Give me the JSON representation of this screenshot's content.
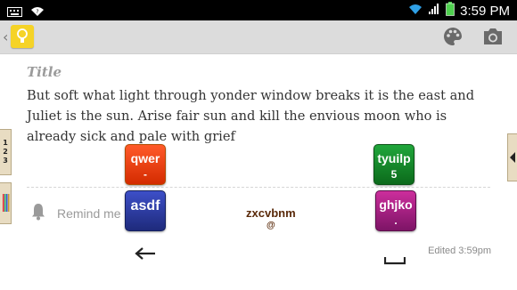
{
  "status_bar": {
    "time": "3:59 PM"
  },
  "note": {
    "title_placeholder": "Title",
    "body": "But soft what light through yonder window breaks it is the east and Juliet is the sun. Arise fair sun and kill the envious moon who is already sick and pale with grief",
    "reminder_label": "Remind me",
    "edited": "Edited 3:59pm"
  },
  "side_tabs": {
    "left_numbers": [
      "1",
      "2",
      "3"
    ]
  },
  "keyboard": {
    "keys": [
      {
        "label": "qwer",
        "sub": "-"
      },
      {
        "label": "asdf",
        "sub": ""
      },
      {
        "label": "tyuilp",
        "sub": "5"
      },
      {
        "label": "ghjko",
        "sub": "."
      }
    ],
    "center_key": {
      "label": "zxcvbnm",
      "sub": "@"
    }
  },
  "icons": {
    "statusbar_left": [
      "keyboard-icon",
      "wifi-icon"
    ],
    "statusbar_right": [
      "wifi-signal-icon",
      "cell-signal-icon",
      "battery-icon"
    ],
    "actionbar": [
      "back-chevron-icon",
      "keep-app-icon",
      "palette-icon",
      "camera-icon"
    ],
    "reminder": "bell-icon",
    "bottom": [
      "left-arrow-icon",
      "space-icon"
    ]
  },
  "colors": {
    "actionbar_bg": "#dcdcdc",
    "app_icon": "#f5d327",
    "key_qwer": "#e84716",
    "key_asdf": "#2a3aa6",
    "key_tyuilp": "#158a2b",
    "key_ghjko": "#a6217f"
  }
}
